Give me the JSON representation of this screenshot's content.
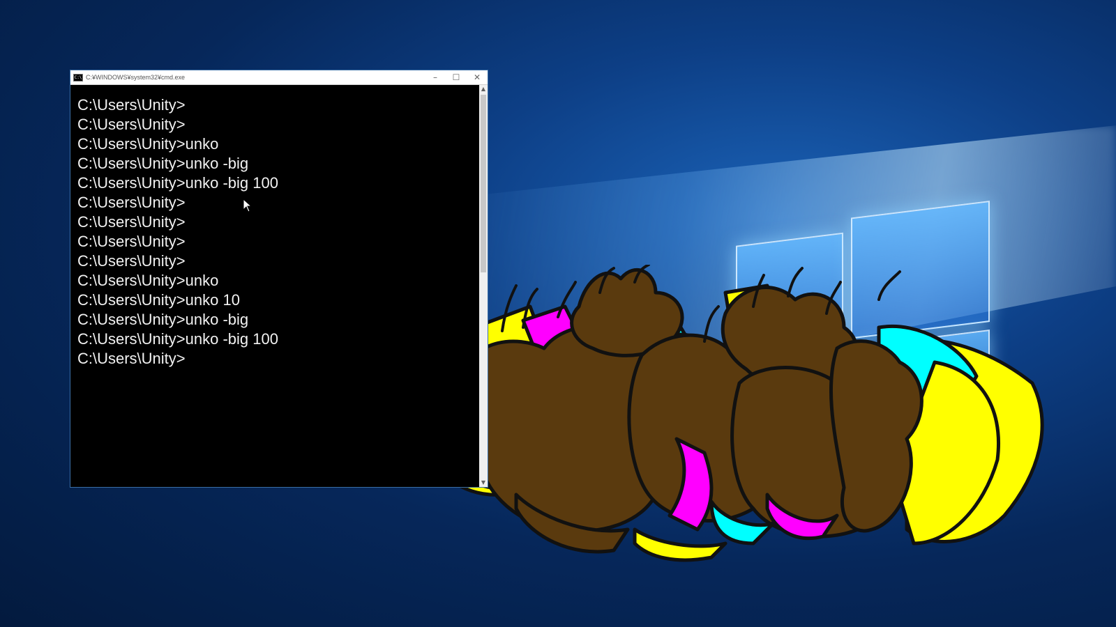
{
  "window": {
    "title": "C:¥WINDOWS¥system32¥cmd.exe",
    "icon_label": "C:\\",
    "controls": [
      "–",
      "☐",
      "✕"
    ]
  },
  "console": {
    "lines": [
      "C:\\Users\\Unity>",
      "C:\\Users\\Unity>",
      "C:\\Users\\Unity>unko",
      "C:\\Users\\Unity>unko -big",
      "C:\\Users\\Unity>unko -big 100",
      "C:\\Users\\Unity>",
      "C:\\Users\\Unity>",
      "C:\\Users\\Unity>",
      "C:\\Users\\Unity>",
      "C:\\Users\\Unity>unko",
      "C:\\Users\\Unity>unko 10",
      "C:\\Users\\Unity>unko -big",
      "C:\\Users\\Unity>unko -big 100",
      "C:\\Users\\Unity>"
    ]
  },
  "scrollbar": {
    "up": "▲",
    "down": "▼"
  },
  "colors": {
    "desktop": "#0d3f86",
    "console_bg": "#000000",
    "console_text": "#f2f2f2",
    "poop": "#5a3a0e",
    "magenta": "#ff00ff",
    "cyan": "#00ffff",
    "yellow": "#ffff00"
  },
  "icons": [
    "cmd-icon",
    "minimize-icon",
    "maximize-icon",
    "close-icon",
    "mouse-pointer-icon",
    "windows-logo"
  ]
}
